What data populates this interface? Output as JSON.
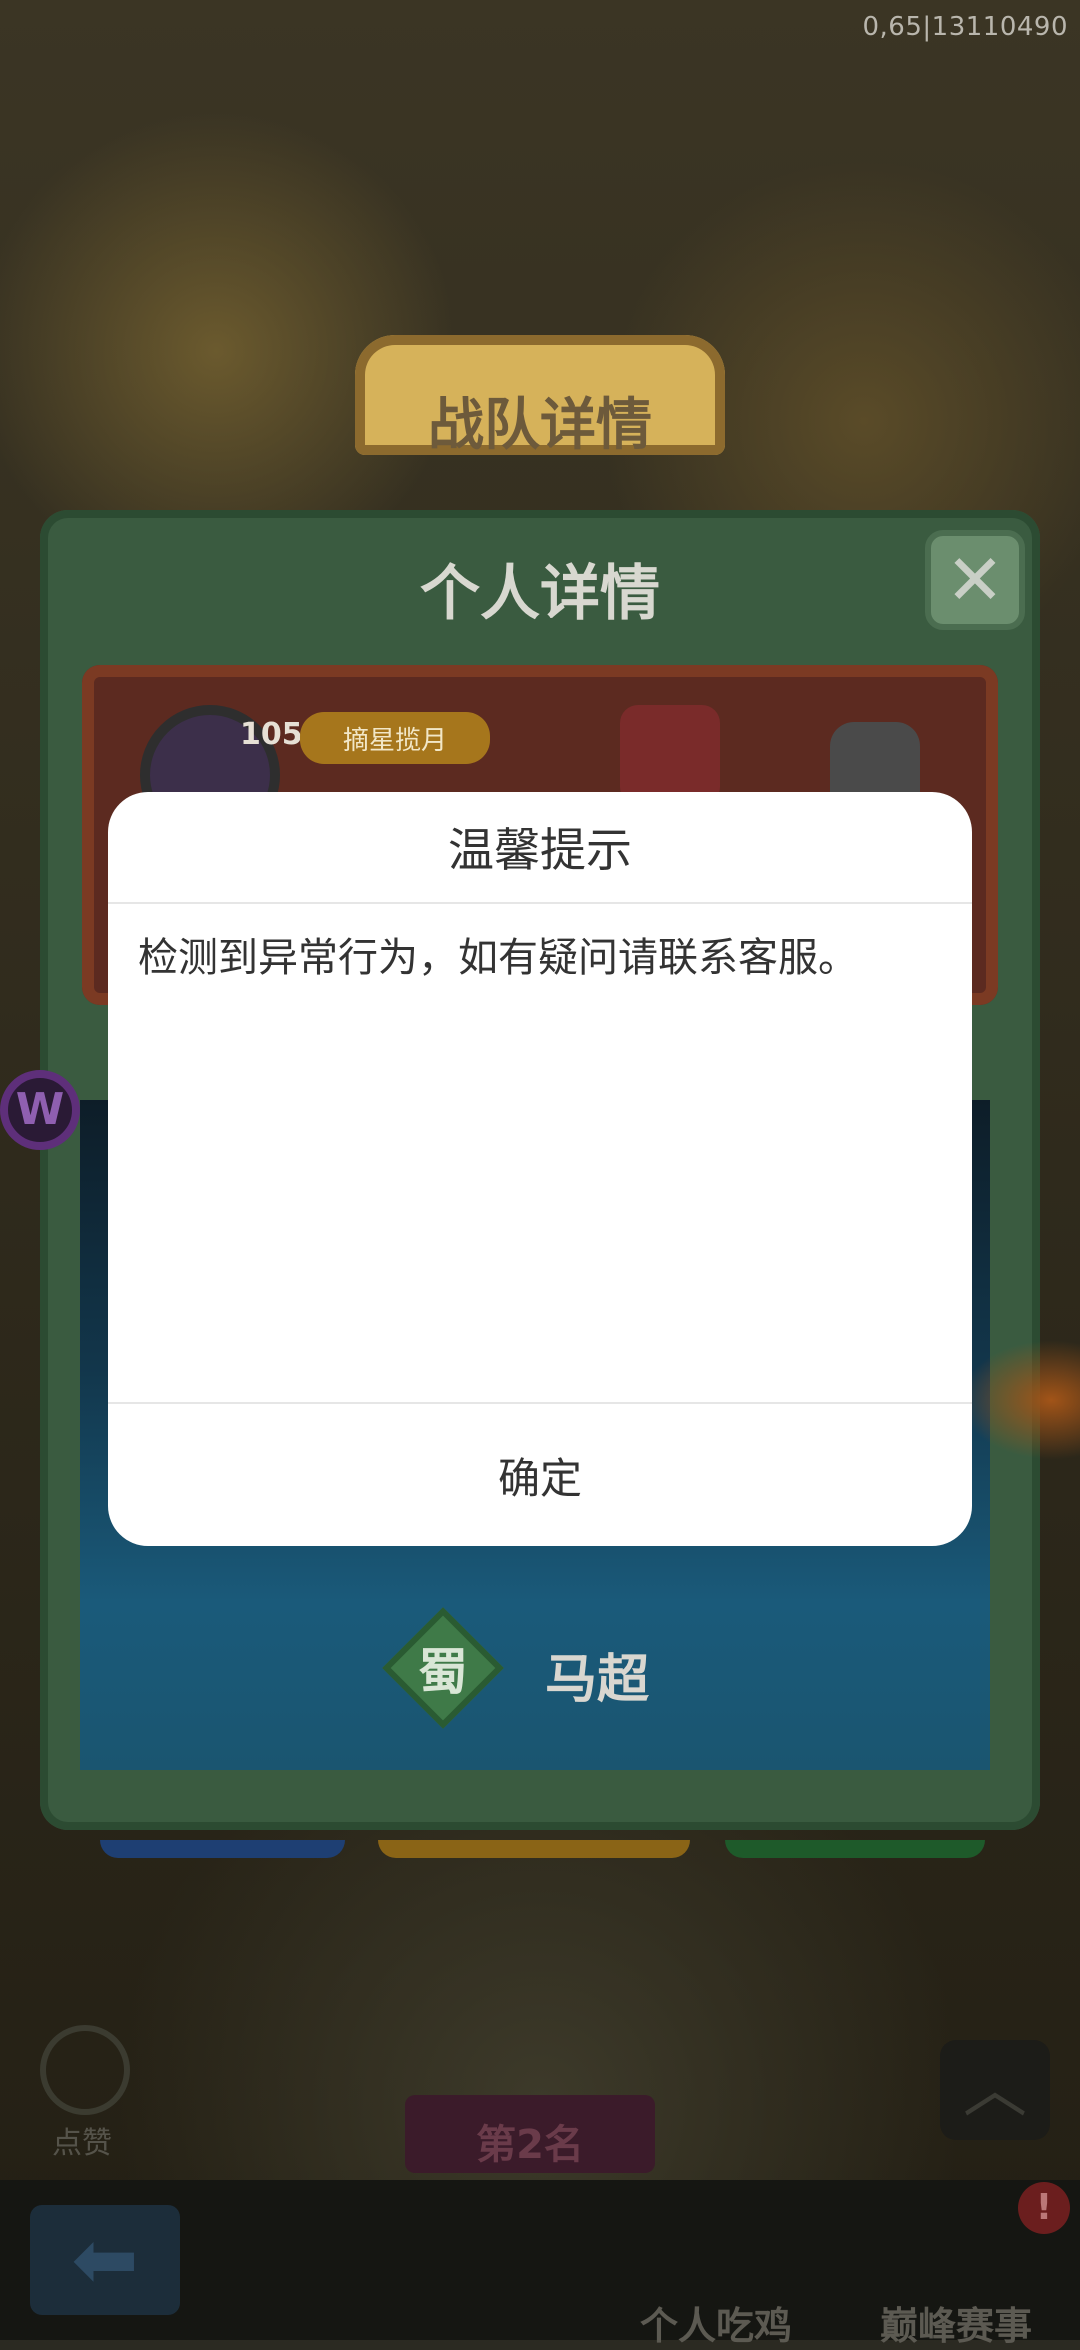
{
  "debug_overlay": "0,65|13110490",
  "team_panel": {
    "title": "战队详情"
  },
  "personal_panel": {
    "title": "个人详情",
    "close_icon": "close-icon",
    "level": "105",
    "badge": "摘星揽月",
    "kingdom": "蜀",
    "hero_name": "马超"
  },
  "bottom": {
    "like_label": "点赞",
    "rank": "第2名",
    "nav_left": "个人吃鸡",
    "nav_right": "巅峰赛事",
    "notify": "!"
  },
  "dialog": {
    "title": "温馨提示",
    "message": "检测到异常行为，如有疑问请联系客服。",
    "confirm": "确定"
  }
}
